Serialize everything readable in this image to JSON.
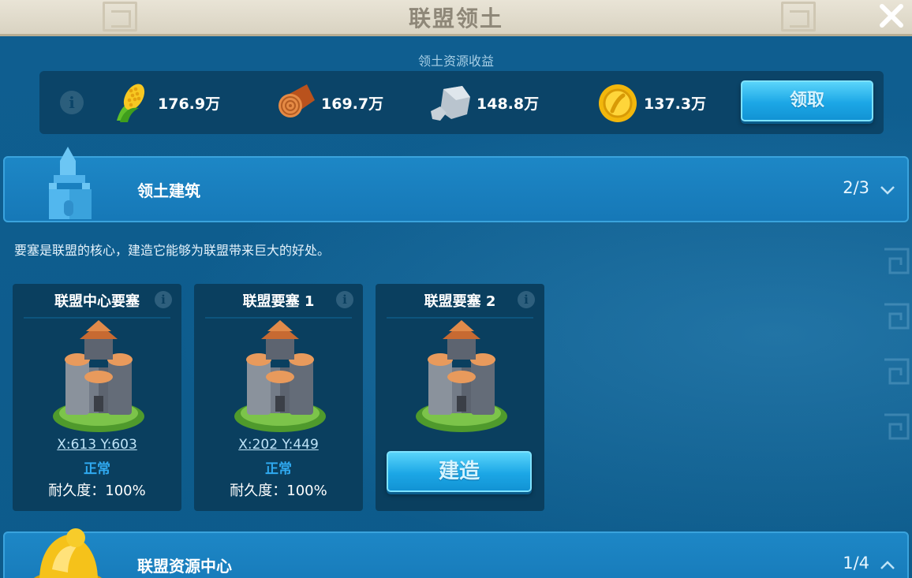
{
  "window": {
    "title": "联盟领土",
    "close_icon": "close-icon"
  },
  "income": {
    "caption": "领土资源收益",
    "resources": [
      {
        "name": "food",
        "icon": "corn-icon",
        "amount": "176.9万"
      },
      {
        "name": "wood",
        "icon": "log-icon",
        "amount": "169.7万"
      },
      {
        "name": "stone",
        "icon": "stone-icon",
        "amount": "148.8万"
      },
      {
        "name": "gold",
        "icon": "gold-coin-icon",
        "amount": "137.3万"
      }
    ],
    "claim_label": "领取"
  },
  "buildings": {
    "title": "领土建筑",
    "count": "2/3",
    "description": "要塞是联盟的核心，建造它能够为联盟带来巨大的好处。",
    "cards": [
      {
        "title": "联盟中心要塞",
        "coords": "X:613 Y:603",
        "status": "正常",
        "durability": "耐久度：100%"
      },
      {
        "title": "联盟要塞 1",
        "coords": "X:202 Y:449",
        "status": "正常",
        "durability": "耐久度：100%"
      },
      {
        "title": "联盟要塞 2",
        "build_label": "建造"
      }
    ]
  },
  "resource_center": {
    "title": "联盟资源中心",
    "count": "1/4"
  },
  "colors": {
    "panel": "#0e5b8c",
    "header": "#1d87c6",
    "button": "#1ca7e6",
    "status": "#2fa9f0"
  }
}
